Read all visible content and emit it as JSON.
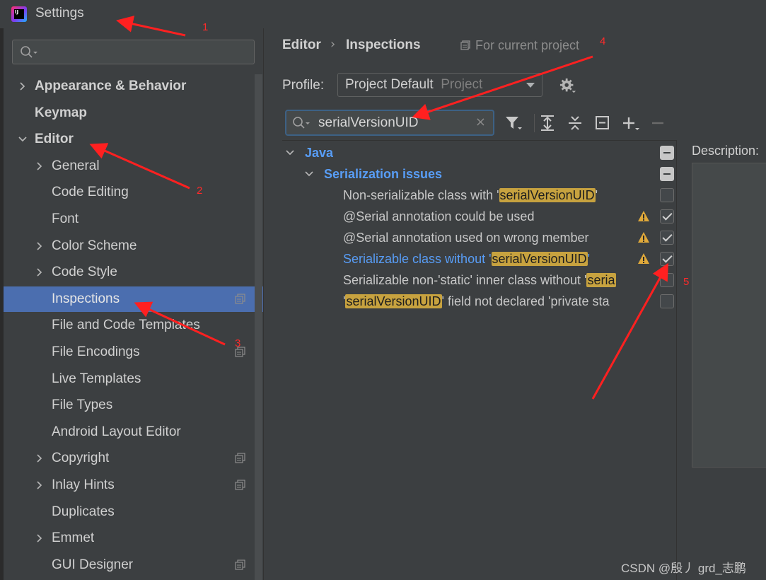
{
  "window": {
    "title": "Settings",
    "app_icon_text": "IJ"
  },
  "sidebar": {
    "search": {
      "value": "",
      "placeholder": ""
    },
    "items": [
      {
        "label": "Appearance & Behavior",
        "bold": true,
        "expandable": true,
        "expanded": false
      },
      {
        "label": "Keymap",
        "bold": true,
        "expandable": false
      },
      {
        "label": "Editor",
        "bold": true,
        "expandable": true,
        "expanded": true
      },
      {
        "label": "General",
        "expandable": true
      },
      {
        "label": "Code Editing"
      },
      {
        "label": "Font"
      },
      {
        "label": "Color Scheme",
        "expandable": true
      },
      {
        "label": "Code Style",
        "expandable": true
      },
      {
        "label": "Inspections",
        "selected": true,
        "project_icon": true
      },
      {
        "label": "File and Code Templates"
      },
      {
        "label": "File Encodings",
        "project_icon": true
      },
      {
        "label": "Live Templates"
      },
      {
        "label": "File Types"
      },
      {
        "label": "Android Layout Editor"
      },
      {
        "label": "Copyright",
        "expandable": true,
        "project_icon": true
      },
      {
        "label": "Inlay Hints",
        "expandable": true,
        "project_icon": true
      },
      {
        "label": "Duplicates"
      },
      {
        "label": "Emmet",
        "expandable": true
      },
      {
        "label": "GUI Designer",
        "project_icon": true
      }
    ]
  },
  "main": {
    "breadcrumb": [
      "Editor",
      "Inspections"
    ],
    "breadcrumb_sep": "›",
    "for_current_project": "For current project",
    "profile_label": "Profile:",
    "profile_value": "Project Default",
    "profile_scope": "Project",
    "filter": {
      "value": "serialVersionUID",
      "clear": "×"
    },
    "description_label": "Description:",
    "tree": [
      {
        "type": "group",
        "label": "Java",
        "level": 0,
        "state": "mixed"
      },
      {
        "type": "group",
        "label": "Serialization issues",
        "level": 1,
        "state": "mixed"
      },
      {
        "pre": "Non-serializable class with '",
        "hl": "serialVersionUID",
        "post": "'",
        "checked": false,
        "warn": false
      },
      {
        "pre": "@Serial annotation could be used",
        "hl": "",
        "post": "",
        "checked": true,
        "warn": true
      },
      {
        "pre": "@Serial annotation used on wrong member",
        "hl": "",
        "post": "",
        "checked": true,
        "warn": true
      },
      {
        "pre": "Serializable class without '",
        "hl": "serialVersionUID",
        "post": "'",
        "checked": true,
        "warn": true,
        "link": true
      },
      {
        "pre": "Serializable non-'static' inner class without '",
        "hl": "seria",
        "post": "",
        "checked": false,
        "warn": false
      },
      {
        "pre": "'",
        "hl": "serialVersionUID",
        "post": "' field not declared 'private sta",
        "checked": false,
        "warn": false
      }
    ]
  },
  "annotations": {
    "numbers": [
      "1",
      "2",
      "3",
      "4",
      "5"
    ],
    "color": "#ff2a2a"
  },
  "watermark": "CSDN @殷丿 grd_志鹏",
  "colors": {
    "selection": "#4b6eaf",
    "link": "#589df6",
    "highlight": "#c7a23f",
    "background": "#3c3f41"
  }
}
